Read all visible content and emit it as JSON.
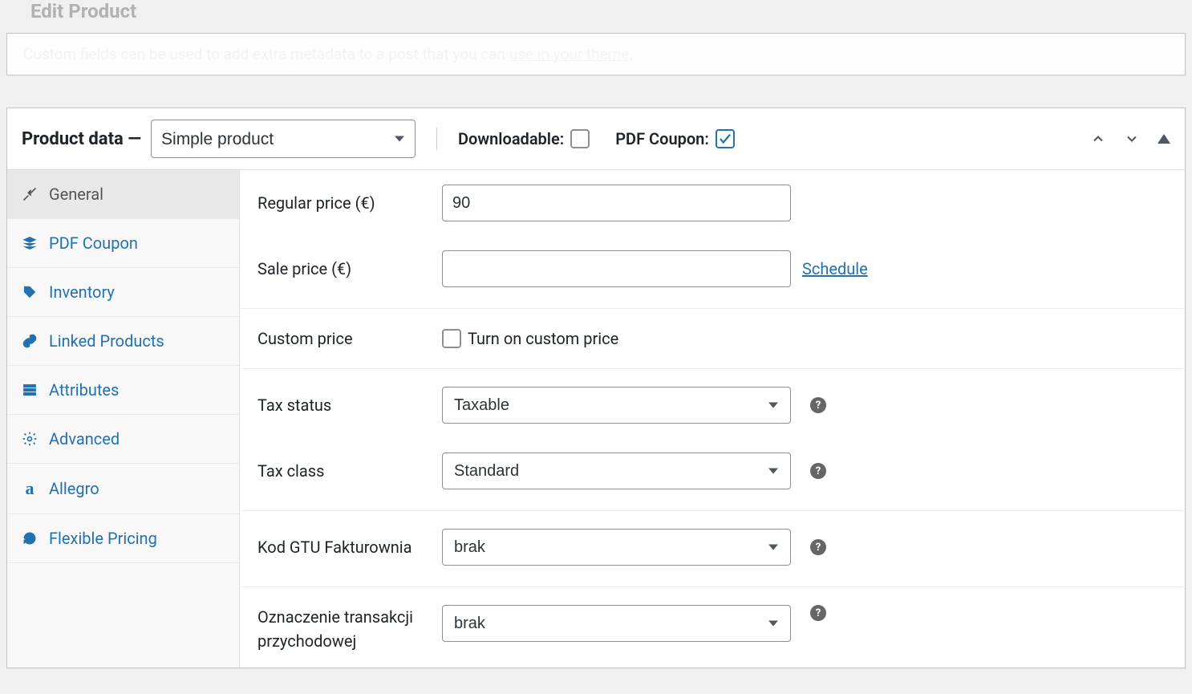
{
  "page_title": "Edit Product",
  "notice_text": "Custom fields can be used to add extra metadata to a post that you can",
  "notice_link": "use in your theme",
  "panel": {
    "title": "Product data —",
    "product_type": "Simple product",
    "downloadable_label": "Downloadable:",
    "downloadable_checked": false,
    "pdf_coupon_label": "PDF Coupon:",
    "pdf_coupon_checked": true
  },
  "tabs": {
    "general": "General",
    "pdf_coupon": "PDF Coupon",
    "inventory": "Inventory",
    "linked_products": "Linked Products",
    "attributes": "Attributes",
    "advanced": "Advanced",
    "allegro": "Allegro",
    "flexible_pricing": "Flexible Pricing"
  },
  "form": {
    "regular_price_label": "Regular price (€)",
    "regular_price_value": "90",
    "sale_price_label": "Sale price (€)",
    "sale_price_value": "",
    "schedule_link": "Schedule",
    "custom_price_label": "Custom price",
    "custom_price_checkbox_label": "Turn on custom price",
    "custom_price_checked": false,
    "tax_status_label": "Tax status",
    "tax_status_value": "Taxable",
    "tax_class_label": "Tax class",
    "tax_class_value": "Standard",
    "kod_gtu_label": "Kod GTU Fakturownia",
    "kod_gtu_value": "brak",
    "oznaczenie_label": "Oznaczenie transakcji przychodowej",
    "oznaczenie_value": "brak"
  }
}
